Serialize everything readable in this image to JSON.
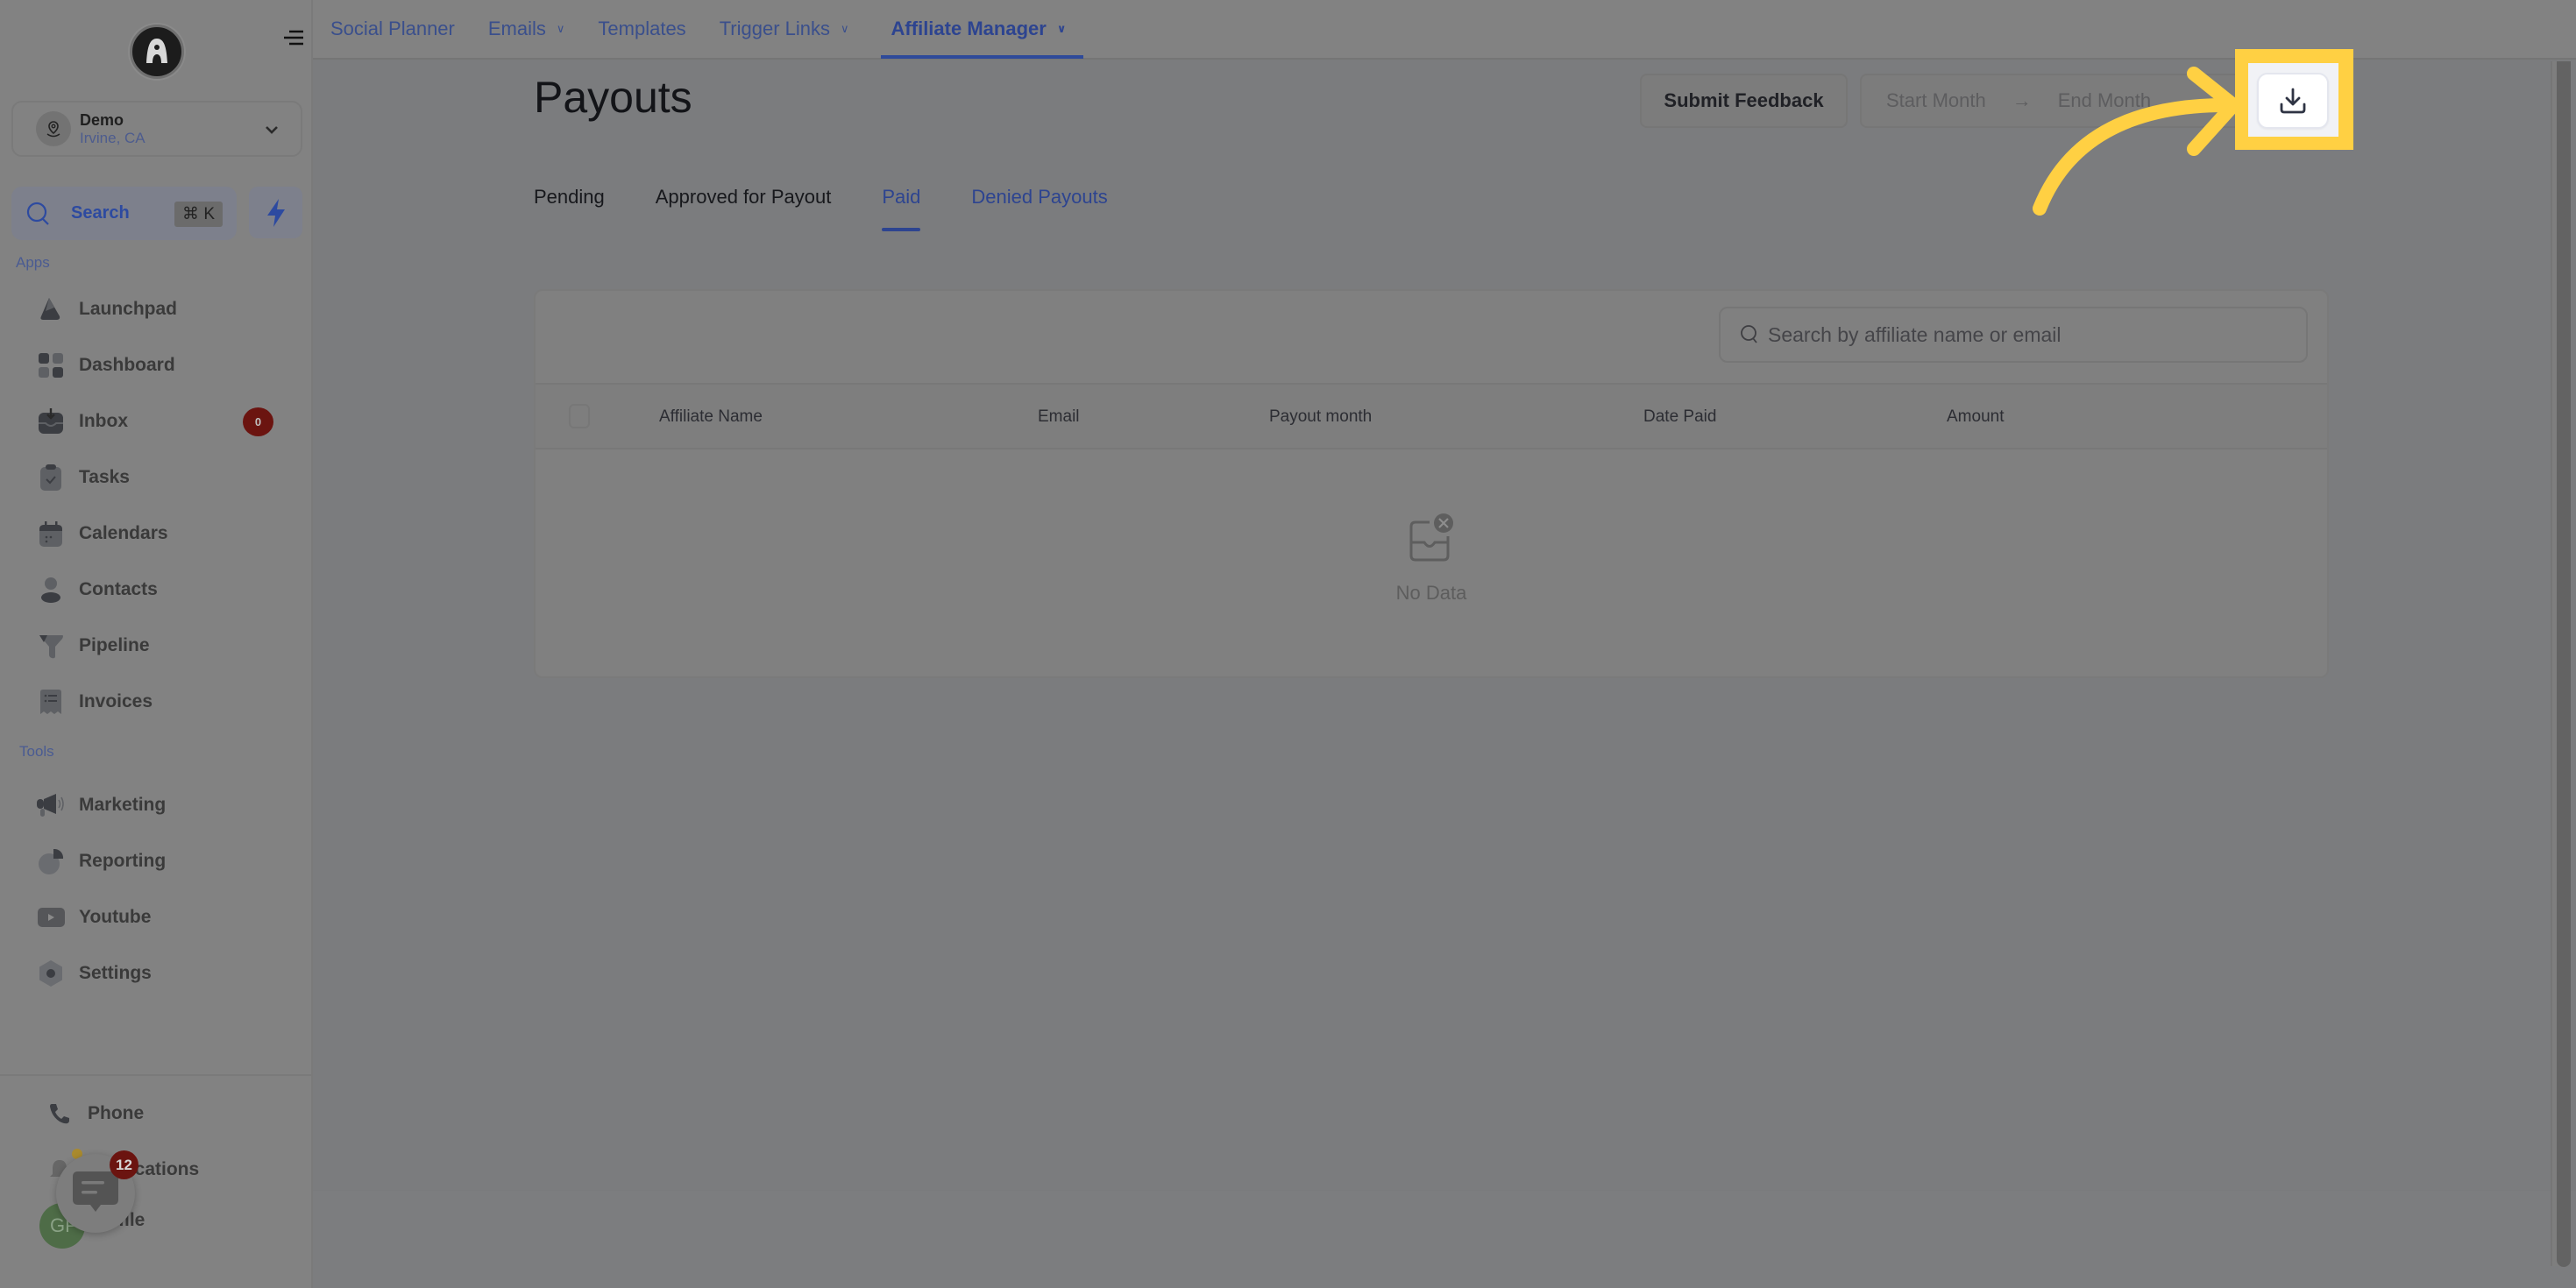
{
  "sidebar": {
    "location": {
      "name": "Demo",
      "city": "Irvine, CA"
    },
    "search": {
      "label": "Search",
      "shortcut": "⌘ K"
    },
    "sections": {
      "apps": "Apps",
      "tools": "Tools"
    },
    "apps": [
      {
        "label": "Launchpad",
        "icon": "rocket-icon"
      },
      {
        "label": "Dashboard",
        "icon": "grid-icon"
      },
      {
        "label": "Inbox",
        "icon": "inbox-icon",
        "badge": "0"
      },
      {
        "label": "Tasks",
        "icon": "clipboard-check-icon"
      },
      {
        "label": "Calendars",
        "icon": "calendar-icon"
      },
      {
        "label": "Contacts",
        "icon": "person-icon"
      },
      {
        "label": "Pipeline",
        "icon": "funnel-icon"
      },
      {
        "label": "Invoices",
        "icon": "receipt-icon"
      }
    ],
    "tools": [
      {
        "label": "Marketing",
        "icon": "megaphone-icon"
      },
      {
        "label": "Reporting",
        "icon": "pie-chart-icon"
      },
      {
        "label": "Youtube",
        "icon": "youtube-icon"
      },
      {
        "label": "Settings",
        "icon": "settings-icon"
      }
    ],
    "bottom": [
      {
        "label": "Phone",
        "icon": "phone-icon"
      },
      {
        "label": "Notifications",
        "icon": "bell-icon"
      },
      {
        "label": "Profile",
        "icon": "avatar-icon"
      }
    ],
    "avatar_initials": "GP",
    "chat_badge": "12"
  },
  "topnav": {
    "items": [
      {
        "label": "Social Planner",
        "dropdown": false,
        "active": false
      },
      {
        "label": "Emails",
        "dropdown": true,
        "active": false
      },
      {
        "label": "Templates",
        "dropdown": false,
        "active": false
      },
      {
        "label": "Trigger Links",
        "dropdown": true,
        "active": false
      },
      {
        "label": "Affiliate Manager",
        "dropdown": true,
        "active": true
      }
    ]
  },
  "page": {
    "title": "Payouts",
    "feedback_label": "Submit Feedback",
    "range": {
      "start_placeholder": "Start Month",
      "end_placeholder": "End Month",
      "separator": "→"
    },
    "download_icon": "download-icon"
  },
  "tabs": [
    {
      "label": "Pending",
      "active": false
    },
    {
      "label": "Approved for Payout",
      "active": false
    },
    {
      "label": "Paid",
      "active": true
    },
    {
      "label": "Denied Payouts",
      "active": false
    }
  ],
  "table": {
    "search_placeholder": "Search by affiliate name or email",
    "columns": [
      "Affiliate Name",
      "Email",
      "Payout month",
      "Date Paid",
      "Amount"
    ],
    "rows": [],
    "empty_text": "No Data"
  },
  "colors": {
    "accent": "#2d4490",
    "highlight": "#ffd043",
    "badge": "#6b1410"
  }
}
